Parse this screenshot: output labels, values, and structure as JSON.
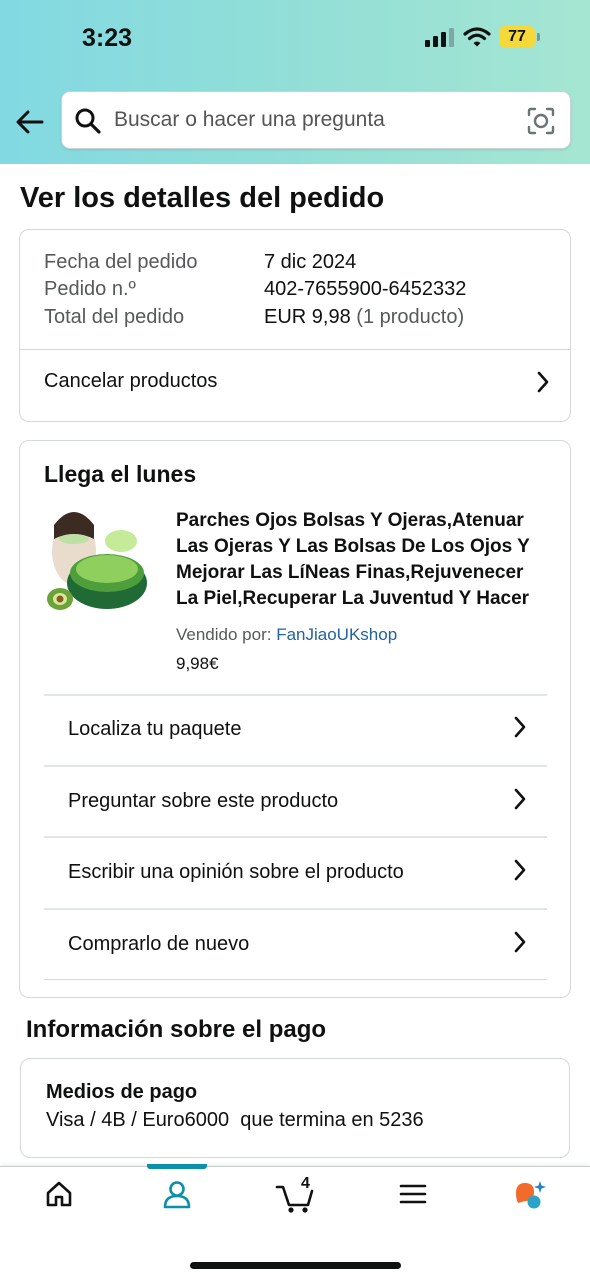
{
  "status_bar": {
    "time": "3:23",
    "battery": "77"
  },
  "search": {
    "placeholder": "Buscar o hacer una pregunta"
  },
  "page": {
    "title": "Ver los detalles del pedido"
  },
  "summary": {
    "date_label": "Fecha del pedido",
    "date_value": "7 dic 2024",
    "order_label": "Pedido n.º",
    "order_value": "402-7655900-6452332",
    "total_label": "Total del pedido",
    "total_value": "EUR 9,98",
    "total_qty": "(1 producto)",
    "cancel_label": "Cancelar productos"
  },
  "shipment": {
    "arrival": "Llega el lunes",
    "product_title": "Parches Ojos Bolsas Y Ojeras,Atenuar Las Ojeras Y Las Bolsas De Los Ojos Y Mejorar Las LíNeas Finas,Rejuvenecer La Piel,Recuperar La Juventud Y Hacer",
    "sold_by_label": "Vendido por:",
    "seller": "FanJiaoUKshop",
    "price": "9,98€",
    "actions": [
      {
        "label": "Localiza tu paquete"
      },
      {
        "label": "Preguntar sobre este producto"
      },
      {
        "label": "Escribir una opinión sobre el producto"
      },
      {
        "label": "Comprarlo de nuevo"
      }
    ]
  },
  "payment": {
    "section_title": "Información sobre el pago",
    "heading": "Medios de pago",
    "detail": "Visa / 4B / Euro6000  que termina en 5236"
  },
  "nav": {
    "cart_count": "4",
    "active": "account"
  },
  "colors": {
    "accent": "#0c8fab",
    "link": "#2162a1",
    "battery": "#f5d93b"
  }
}
